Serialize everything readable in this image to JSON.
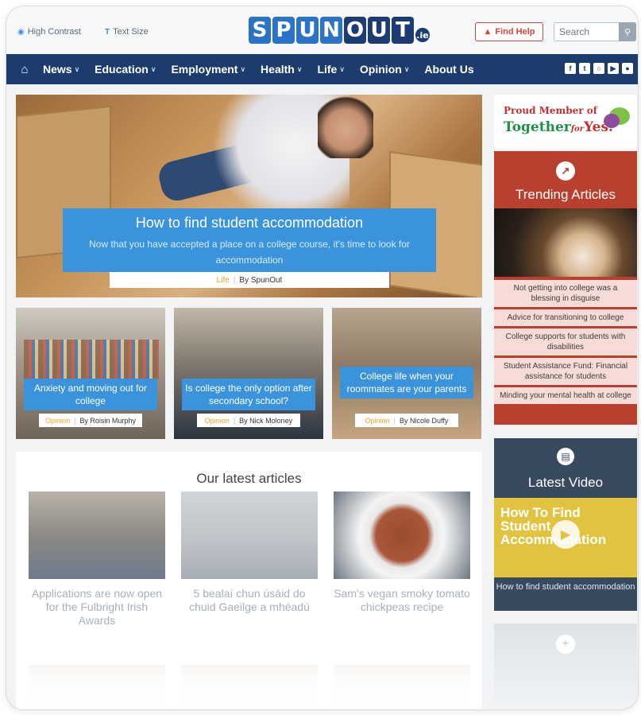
{
  "topbar": {
    "high_contrast": "High Contrast",
    "text_size": "Text Size",
    "logo": "SPUNOUT.ie",
    "find_help": "Find Help",
    "search_placeholder": "Search"
  },
  "nav": {
    "items": [
      {
        "label": "News",
        "has_menu": true
      },
      {
        "label": "Education",
        "has_menu": true
      },
      {
        "label": "Employment",
        "has_menu": true
      },
      {
        "label": "Health",
        "has_menu": true
      },
      {
        "label": "Life",
        "has_menu": true
      },
      {
        "label": "Opinion",
        "has_menu": true
      },
      {
        "label": "About Us",
        "has_menu": false
      }
    ],
    "social_icons": [
      "facebook-icon",
      "twitter-icon",
      "instagram-icon",
      "youtube-icon",
      "snapchat-icon"
    ]
  },
  "hero": {
    "title": "How to find student accommodation",
    "subtitle": "Now that you have accepted a place on a college course, it's time to look for accommodation",
    "category": "Life",
    "author": "By SpunOut"
  },
  "cards": [
    {
      "title": "Anxiety and moving out for college",
      "category": "Opinion",
      "author": "By Roisin Murphy"
    },
    {
      "title": "Is college the only option after secondary school?",
      "category": "Opinion",
      "author": "By Nick Moloney"
    },
    {
      "title": "College life when your roommates are your parents",
      "category": "Opinion",
      "author": "By Nicole Duffy"
    }
  ],
  "sidebar": {
    "proud_line1": "Proud Member of",
    "proud_line2a": "Together",
    "proud_line2b": "for",
    "proud_line2c": "Yes.",
    "trending_title": "Trending Articles",
    "trending": [
      "Not getting into college was a blessing in disguise",
      "Advice for transitioning to college",
      "College supports for students with disabilities",
      "Student Assistance Fund: Financial assistance for students",
      "Minding your mental health at college"
    ],
    "video_title": "Latest Video",
    "video_thumb_text": "How To Find Student Accommodation",
    "video_caption": "How to find student accommodation"
  },
  "latest": {
    "heading": "Our latest articles",
    "articles": [
      {
        "title": "Applications are now open for the Fulbright Irish Awards"
      },
      {
        "title": "5 bealaí chun úsáid do chuid Gaeilge a mhéadú"
      },
      {
        "title": "Sam's vegan smoky tomato chickpeas recipe"
      }
    ]
  },
  "colors": {
    "nav": "#1d3c6e",
    "caption_blue": "#3b93db",
    "trending_red": "#b9402e",
    "find_help_red": "#d8443d",
    "category_gold": "#e4a21f"
  }
}
